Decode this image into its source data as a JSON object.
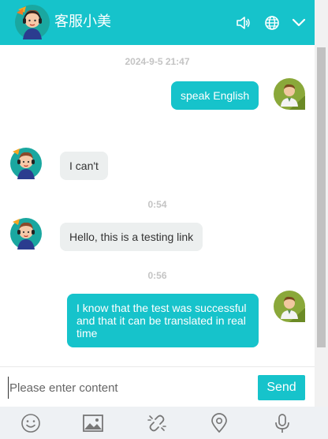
{
  "header": {
    "title": "客服小美",
    "accent_color": "#16c3cb",
    "icons": [
      "agent-avatar",
      "sound-icon",
      "globe-icon",
      "chevron-down-icon"
    ]
  },
  "messages": [
    {
      "kind": "time",
      "text": "2024-9-5 21:47"
    },
    {
      "kind": "out",
      "sender": "user",
      "text": "speak English"
    },
    {
      "kind": "in",
      "sender": "agent",
      "text": "I can't"
    },
    {
      "kind": "time",
      "text": "0:54"
    },
    {
      "kind": "in",
      "sender": "agent",
      "text": "Hello, this is a testing link"
    },
    {
      "kind": "time",
      "text": "0:56"
    },
    {
      "kind": "out",
      "sender": "user",
      "text": "I know that the test was successful and that it can be translated in real time"
    }
  ],
  "composer": {
    "placeholder": "Please enter content",
    "value": "",
    "send_label": "Send"
  },
  "toolbar": {
    "icons": [
      "emoji-icon",
      "image-icon",
      "link-icon",
      "location-icon",
      "microphone-icon"
    ]
  }
}
